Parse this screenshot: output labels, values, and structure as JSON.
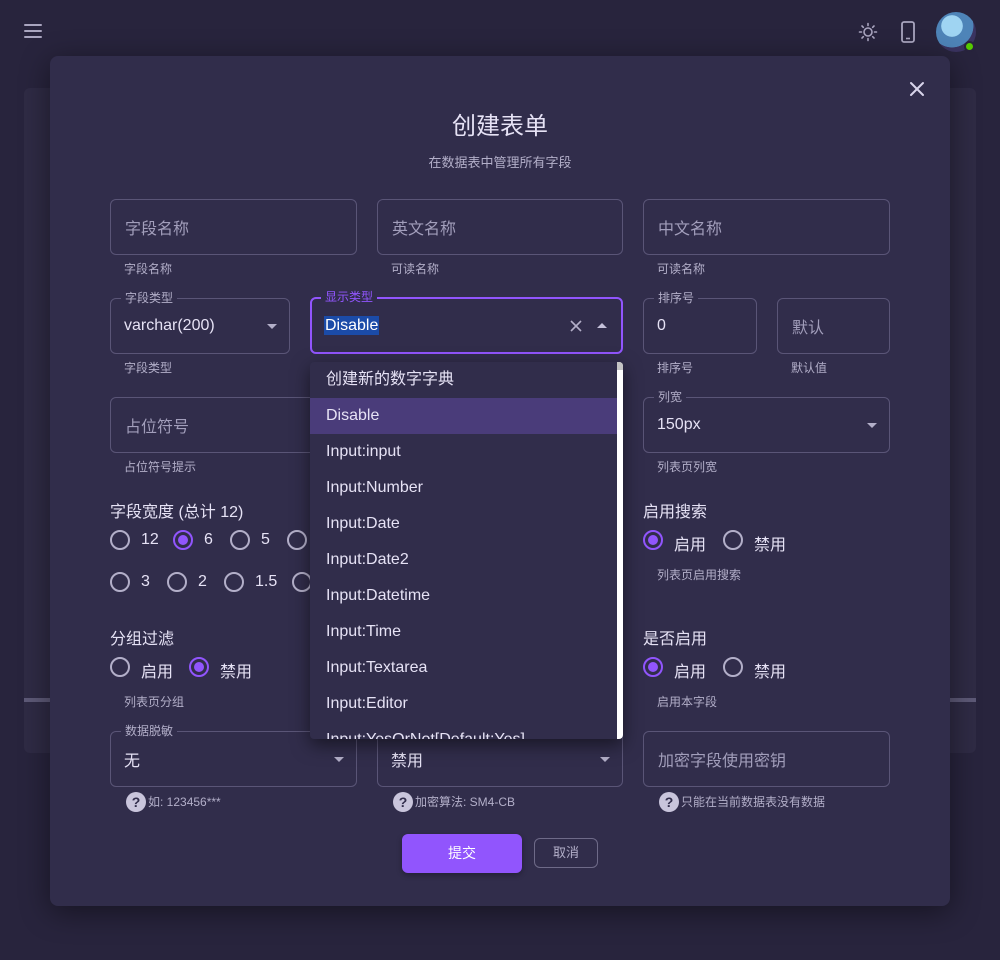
{
  "dialog": {
    "title": "创建表单",
    "subtitle": "在数据表中管理所有字段"
  },
  "fields": {
    "field_name": {
      "placeholder": "字段名称",
      "hint": "字段名称"
    },
    "english_name": {
      "placeholder": "英文名称",
      "hint": "可读名称"
    },
    "chinese_name": {
      "placeholder": "中文名称",
      "hint": "可读名称"
    },
    "field_type": {
      "label": "字段类型",
      "value": "varchar(200)",
      "hint": "字段类型"
    },
    "display_type": {
      "label": "显示类型",
      "value": "Disable"
    },
    "sort_order": {
      "label": "排序号",
      "value": "0",
      "hint": "排序号"
    },
    "default_value": {
      "placeholder": "默认",
      "hint": "默认值"
    },
    "placeholder_text": {
      "placeholder": "占位符号",
      "hint": "占位符号提示"
    },
    "column_width": {
      "label": "列宽",
      "value": "150px",
      "hint": "列表页列宽"
    },
    "data_masking": {
      "label": "数据脱敏",
      "value": "无",
      "hint": "如: 123456***"
    },
    "encryption": {
      "value": "禁用",
      "hint": "加密算法: SM4-CB"
    },
    "encryption_key": {
      "placeholder": "加密字段使用密钥",
      "hint": "只能在当前数据表没有数据"
    }
  },
  "field_width": {
    "title": "字段宽度 (总计 12)",
    "row1": [
      "12",
      "6",
      "5"
    ],
    "row2": [
      "3",
      "2",
      "1.5"
    ],
    "selected": "6"
  },
  "enable_search": {
    "title": "启用搜索",
    "options": [
      "启用",
      "禁用"
    ],
    "selected": "启用",
    "hint": "列表页启用搜索"
  },
  "group_filter": {
    "title": "分组过滤",
    "options": [
      "启用",
      "禁用"
    ],
    "selected": "禁用",
    "hint": "列表页分组"
  },
  "is_enabled": {
    "title": "是否启用",
    "options": [
      "启用",
      "禁用"
    ],
    "selected": "启用",
    "hint": "启用本字段"
  },
  "dropdown": {
    "items": [
      "创建新的数字字典",
      "Disable",
      "Input:input",
      "Input:Number",
      "Input:Date",
      "Input:Date2",
      "Input:Datetime",
      "Input:Time",
      "Input:Textarea",
      "Input:Editor",
      "Input:YesOrNot[Default:Yes]"
    ],
    "active": "Disable"
  },
  "buttons": {
    "submit": "提交",
    "cancel": "取消"
  },
  "icons": {
    "menu": "hamburger-icon",
    "theme": "sun-icon",
    "device": "phone-icon",
    "close": "close-icon",
    "help": "help-icon"
  },
  "colors": {
    "accent": "#9155fd",
    "background": "#28243d",
    "dialog": "#312d4b",
    "online": "#56ca00"
  }
}
